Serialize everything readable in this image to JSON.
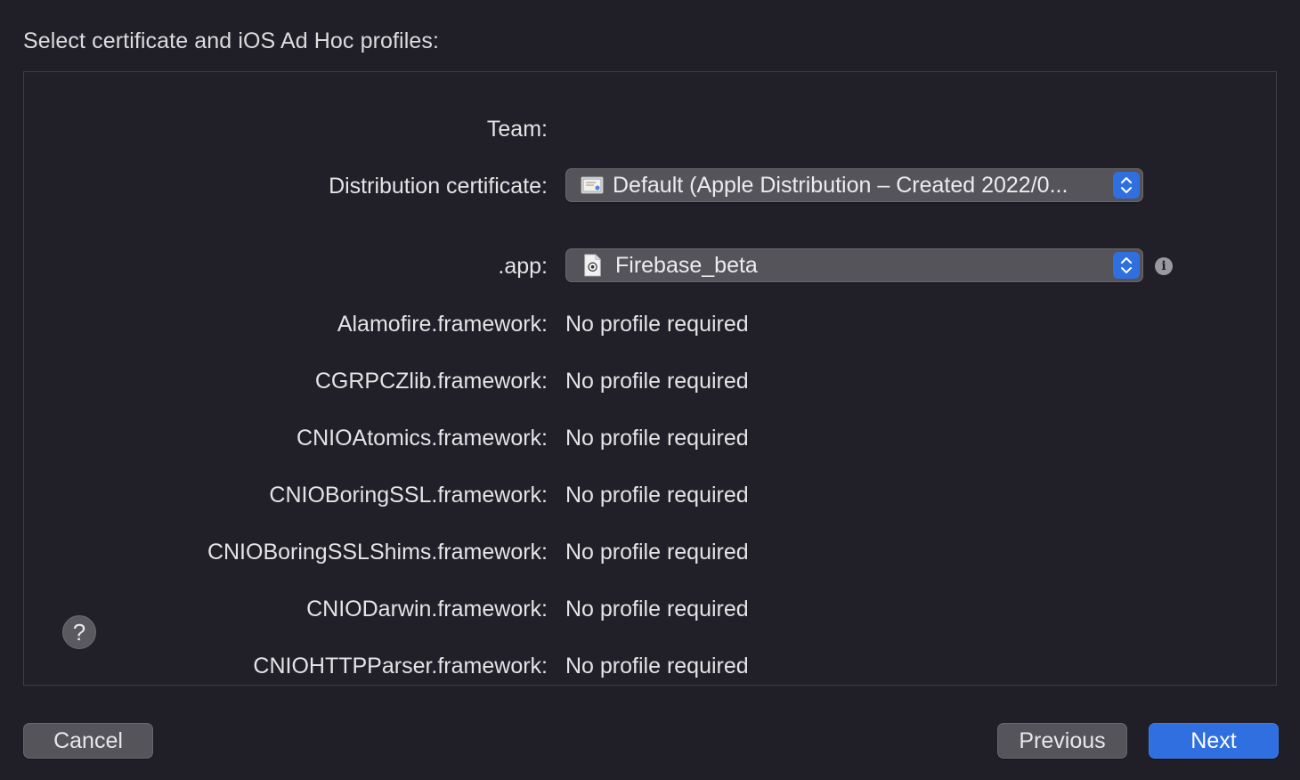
{
  "heading": "Select certificate and iOS Ad Hoc profiles:",
  "team": {
    "label": "Team:",
    "value": ""
  },
  "certificate": {
    "label": "Distribution certificate:",
    "selected": "Default (Apple Distribution – Created 2022/0...",
    "icon": "certificate-icon"
  },
  "app": {
    "label": ".app:",
    "selected": "Firebase_beta",
    "icon": "provisioning-profile-icon",
    "info_icon": "info-icon"
  },
  "frameworks": [
    {
      "label": "Alamofire.framework:",
      "value": "No profile required"
    },
    {
      "label": "CGRPCZlib.framework:",
      "value": "No profile required"
    },
    {
      "label": "CNIOAtomics.framework:",
      "value": "No profile required"
    },
    {
      "label": "CNIOBoringSSL.framework:",
      "value": "No profile required"
    },
    {
      "label": "CNIOBoringSSLShims.framework:",
      "value": "No profile required"
    },
    {
      "label": "CNIODarwin.framework:",
      "value": "No profile required"
    },
    {
      "label": "CNIOHTTPParser.framework:",
      "value": "No profile required"
    }
  ],
  "help_button": "?",
  "buttons": {
    "cancel": "Cancel",
    "previous": "Previous",
    "next": "Next"
  },
  "colors": {
    "background": "#201f27",
    "accent": "#2f6fe0",
    "control": "#55545b"
  }
}
